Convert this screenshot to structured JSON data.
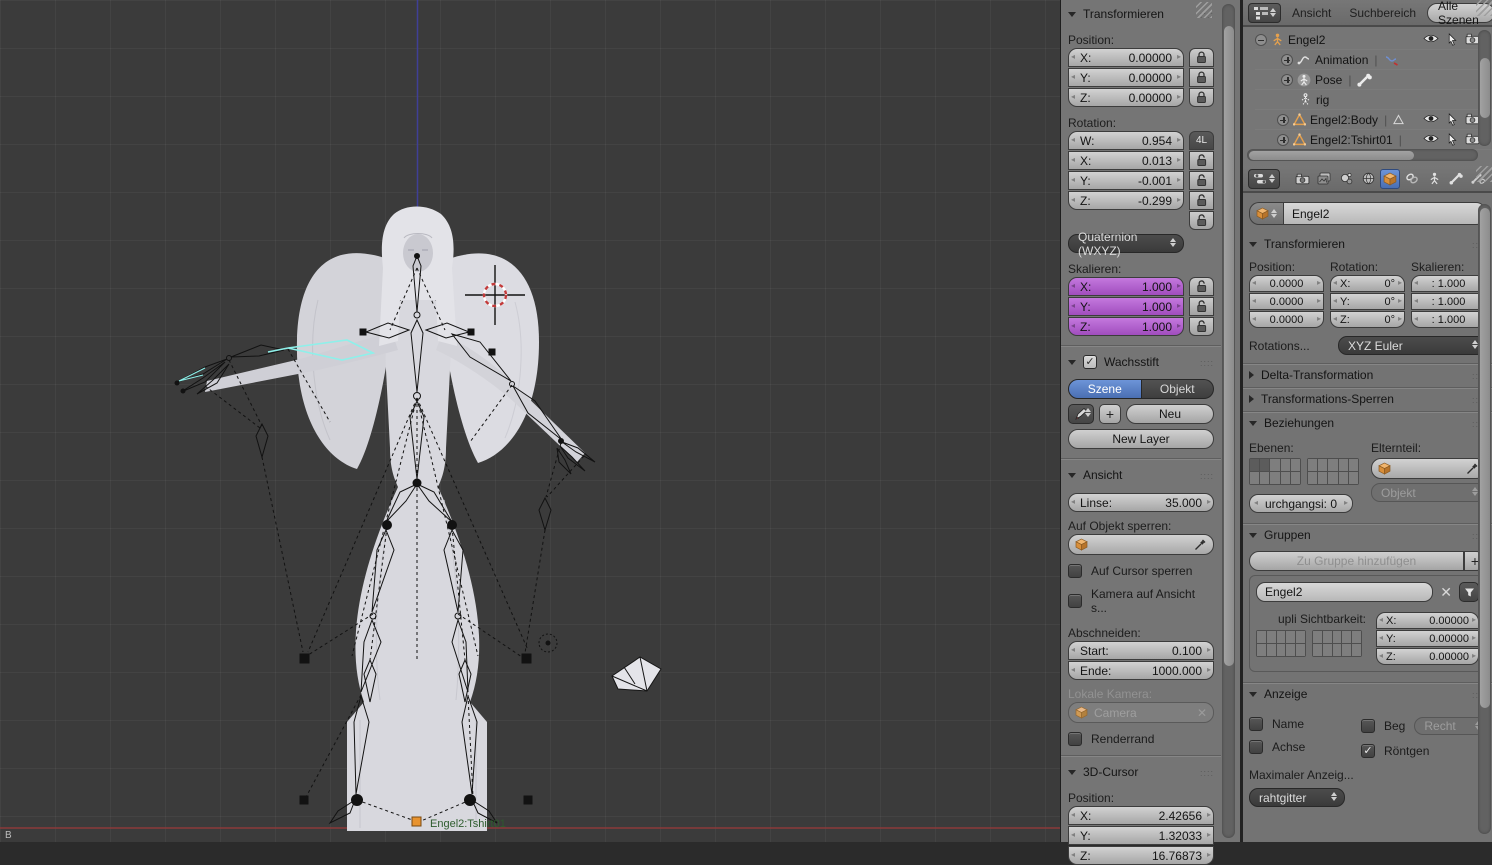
{
  "colors": {
    "accent_blue": "#5680c2",
    "scale_purple": "#b05fc8",
    "object_orange": "#e09133",
    "selected_bone_cyan": "#8ef0ea",
    "axis_red": "#8b3a3a",
    "axis_blue": "#3f3f96"
  },
  "viewport": {
    "object_label": "Engel2:Tshirt01",
    "corner_letter": "B"
  },
  "npanel": {
    "transform": {
      "title": "Transformieren",
      "position_label": "Position:",
      "position": [
        {
          "label": "X:",
          "value": "0.00000"
        },
        {
          "label": "Y:",
          "value": "0.00000"
        },
        {
          "label": "Z:",
          "value": "0.00000"
        }
      ],
      "rotation_label": "Rotation:",
      "lock4l": "4L",
      "rotation": [
        {
          "label": "W:",
          "value": "0.954"
        },
        {
          "label": "X:",
          "value": "0.013"
        },
        {
          "label": "Y:",
          "value": "-0.001"
        },
        {
          "label": "Z:",
          "value": "-0.299"
        }
      ],
      "rotation_mode": "Quaternion (WXYZ)",
      "scale_label": "Skalieren:",
      "scale": [
        {
          "label": "X:",
          "value": "1.000"
        },
        {
          "label": "Y:",
          "value": "1.000"
        },
        {
          "label": "Z:",
          "value": "1.000"
        }
      ]
    },
    "grease": {
      "title": "Wachsstift",
      "tab_scene": "Szene",
      "tab_object": "Objekt",
      "new_button": "Neu",
      "new_layer_button": "New Layer"
    },
    "view": {
      "title": "Ansicht",
      "lens_label": "Linse:",
      "lens_value": "35.000",
      "lock_object_label": "Auf Objekt sperren:",
      "lock_cursor_label": "Auf Cursor sperren",
      "camera_view_label": "Kamera auf Ansicht s...",
      "clip_label": "Abschneiden:",
      "clip_start_label": "Start:",
      "clip_start_value": "0.100",
      "clip_end_label": "Ende:",
      "clip_end_value": "1000.000",
      "local_camera_label": "Lokale Kamera:",
      "camera_value": "Camera",
      "render_border_label": "Renderrand"
    },
    "cursor3d": {
      "title": "3D-Cursor",
      "position_label": "Position:",
      "position": [
        {
          "label": "X:",
          "value": "2.42656"
        },
        {
          "label": "Y:",
          "value": "1.32033"
        },
        {
          "label": "Z:",
          "value": "16.76873"
        }
      ]
    }
  },
  "outliner": {
    "menu_view": "Ansicht",
    "menu_search": "Suchbereich",
    "scenes_button": "Alle Szenen",
    "rows": [
      {
        "name": "Engel2"
      },
      {
        "name": "Animation"
      },
      {
        "name": "Pose"
      },
      {
        "name": "rig"
      },
      {
        "name": "Engel2:Body"
      },
      {
        "name": "Engel2:Tshirt01"
      }
    ]
  },
  "properties": {
    "id_name": "Engel2",
    "transform": {
      "title": "Transformieren",
      "position_label": "Position:",
      "rotation_label": "Rotation:",
      "scale_label": "Skalieren:",
      "position": [
        "0.0000",
        "0.0000",
        "0.0000"
      ],
      "rotation": [
        {
          "label": "X:",
          "value": "0°"
        },
        {
          "label": "Y:",
          "value": "0°"
        },
        {
          "label": "Z:",
          "value": "0°"
        }
      ],
      "scale": [
        ": 1.000",
        ": 1.000",
        ": 1.000"
      ],
      "rotmode_label": "Rotations...",
      "rotmode_value": "XYZ Euler"
    },
    "delta_title": "Delta-Transformation",
    "locks_title": "Transformations-Sperren",
    "relations": {
      "title": "Beziehungen",
      "layers_label": "Ebenen:",
      "parent_label": "Elternteil:",
      "parent_type": "Objekt",
      "pass_index": "urchgangsi: 0"
    },
    "groups": {
      "title": "Gruppen",
      "add_button": "Zu Gruppe hinzufügen",
      "group_name": "Engel2",
      "dupli_label": "upli Sichtbarkeit:",
      "offset": [
        {
          "label": "X:",
          "value": "0.00000"
        },
        {
          "label": "Y:",
          "value": "0.00000"
        },
        {
          "label": "Z:",
          "value": "0.00000"
        }
      ]
    },
    "display": {
      "title": "Anzeige",
      "name_label": "Name",
      "axis_label": "Achse",
      "bounds_label": "Beg",
      "bounds_type": "Recht",
      "xray_label": "Röntgen",
      "max_draw_label": "Maximaler Anzeig...",
      "draw_type": "rahtgitter"
    }
  }
}
